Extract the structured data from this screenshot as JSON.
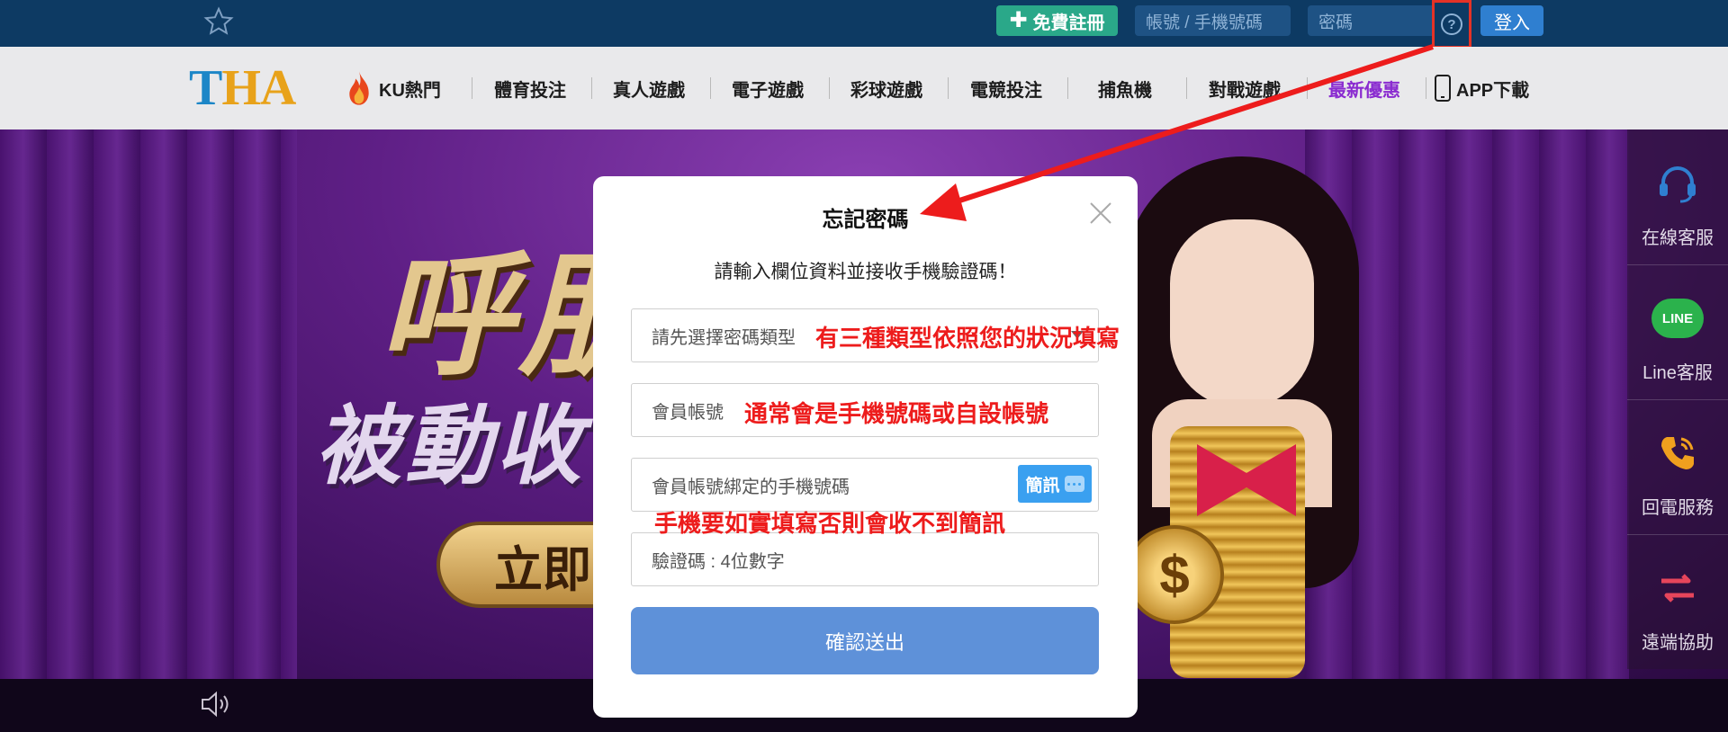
{
  "topbar": {
    "register_label": "免費註冊",
    "account_placeholder": "帳號 / 手機號碼",
    "password_placeholder": "密碼",
    "help_symbol": "?",
    "login_label": "登入"
  },
  "logo": {
    "part1": "T",
    "part2": "HA"
  },
  "nav": {
    "items": [
      {
        "label": "KU熱門",
        "icon": "fire-icon"
      },
      {
        "label": "體育投注"
      },
      {
        "label": "真人遊戲"
      },
      {
        "label": "電子遊戲"
      },
      {
        "label": "彩球遊戲"
      },
      {
        "label": "電競投注"
      },
      {
        "label": "捕魚機"
      },
      {
        "label": "對戰遊戲"
      },
      {
        "label": "最新優惠",
        "color": "#8a2bd0"
      },
      {
        "label": "APP下載",
        "icon": "phone-icon"
      }
    ]
  },
  "banner": {
    "title": "呼朋",
    "subtitle": "被動收",
    "button": "立即"
  },
  "sidebar": {
    "items": [
      {
        "label": "在線客服",
        "icon": "headset-icon"
      },
      {
        "label": "Line客服",
        "icon": "line-icon",
        "icon_text": "LINE"
      },
      {
        "label": "回電服務",
        "icon": "phone-call-icon"
      },
      {
        "label": "遠端協助",
        "icon": "remote-arrows-icon"
      }
    ]
  },
  "modal": {
    "title": "忘記密碼",
    "description": "請輸入欄位資料並接收手機驗證碼！",
    "fields": {
      "password_type": "請先選擇密碼類型",
      "member_account": "會員帳號",
      "bound_phone": "會員帳號綁定的手機號碼",
      "verify_code": "驗證碼 : 4位數字"
    },
    "sms_label": "簡訊",
    "submit_label": "確認送出"
  },
  "annotations": {
    "type_note": "有三種類型依照您的狀況填寫",
    "account_note": "通常會是手機號碼或自設帳號",
    "phone_note": "手機要如實填寫否則會收不到簡訊"
  },
  "colors": {
    "topbar_bg": "#0d3a63",
    "register_green": "#2aa889",
    "login_blue": "#2f7fd0",
    "promo_purple": "#8a2bd0",
    "annotation_red": "#ed1c1c",
    "submit_blue": "#5e91d9",
    "sms_blue": "#3aa0f0",
    "line_green": "#2bb24c"
  }
}
